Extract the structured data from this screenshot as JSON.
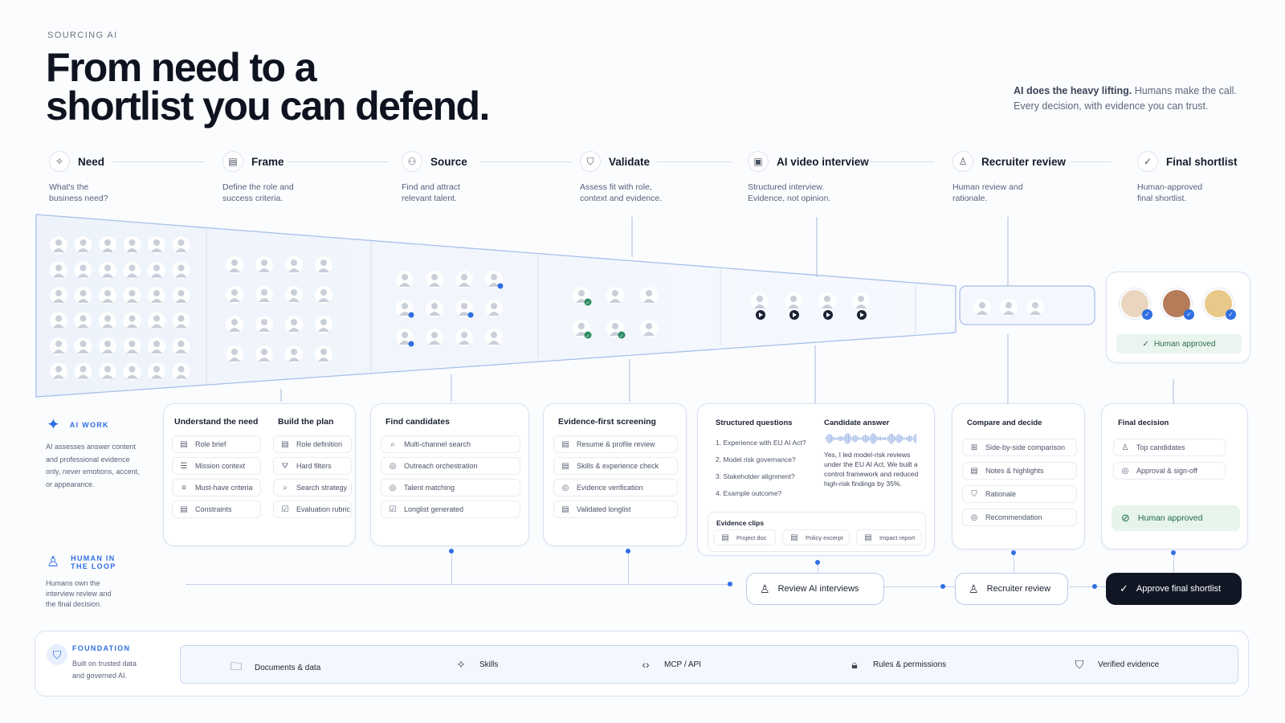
{
  "eyebrow": "SOURCING AI",
  "hero": {
    "line1": "From need to a",
    "line2": "shortlist you can defend."
  },
  "tagline": {
    "bold": "AI does the heavy lifting.",
    "rest": " Humans make the call.",
    "line2": "Every decision, with evidence you can trust."
  },
  "stages": [
    {
      "icon": "sparkle-icon",
      "title": "Need",
      "desc": "What's the business need?"
    },
    {
      "icon": "clipboard-icon",
      "title": "Frame",
      "desc": "Define the role and success criteria."
    },
    {
      "icon": "people-icon",
      "title": "Source",
      "desc": "Find and attract relevant talent."
    },
    {
      "icon": "shield-check-icon",
      "title": "Validate",
      "desc": "Assess fit with role, context and evidence."
    },
    {
      "icon": "video-icon",
      "title": "AI video interview",
      "desc": "Structured interview. Evidence, not opinion."
    },
    {
      "icon": "person-icon",
      "title": "Recruiter review",
      "desc": "Human review and rationale."
    },
    {
      "icon": "check-circle-icon",
      "title": "Final shortlist",
      "desc": "Human-approved final shortlist."
    }
  ],
  "shortlist": {
    "approved_label": "Human approved"
  },
  "ai_work": {
    "label": "AI WORK",
    "desc": "AI assesses answer content and professional evidence only, never emotions, accent, or appearance."
  },
  "hitl": {
    "label_line1": "HUMAN IN",
    "label_line2": "THE LOOP",
    "desc": "Humans own the interview review and the final decision."
  },
  "cards": {
    "frame": {
      "col1_title": "Understand the need",
      "col1_items": [
        "Role brief",
        "Mission context",
        "Must-have criteria",
        "Constraints"
      ],
      "col2_title": "Build the plan",
      "col2_items": [
        "Role definition",
        "Hard filters",
        "Search strategy",
        "Evaluation rubric"
      ]
    },
    "source": {
      "title": "Find candidates",
      "items": [
        "Multi-channel search",
        "Outreach orchestration",
        "Talent matching",
        "Longlist generated"
      ]
    },
    "validate": {
      "title": "Evidence-first screening",
      "items": [
        "Resume & profile review",
        "Skills & experience check",
        "Evidence verification",
        "Validated longlist"
      ]
    },
    "interview": {
      "q_title": "Structured questions",
      "questions": [
        "1. Experience with EU AI Act?",
        "2. Model risk governance?",
        "3. Stakeholder alignment?",
        "4. Example outcome?"
      ],
      "a_title": "Candidate answer",
      "answer": "Yes, I led model-risk reviews under the EU AI Act. We built a control framework and reduced high-risk findings by 35%.",
      "clips_title": "Evidence clips",
      "clips": [
        "Project doc",
        "Policy excerpt",
        "Impact report"
      ]
    },
    "review": {
      "title": "Compare and decide",
      "items": [
        "Side-by-side comparison",
        "Notes & highlights",
        "Rationale",
        "Recommendation"
      ]
    },
    "final": {
      "title": "Final decision",
      "items": [
        "Top candidates",
        "Approval & sign-off"
      ],
      "approved": "Human approved"
    }
  },
  "actions": {
    "review_interviews": "Review AI interviews",
    "recruiter_review": "Recruiter review",
    "approve": "Approve final shortlist"
  },
  "foundation": {
    "label": "FOUNDATION",
    "desc": "Built on trusted data and governed AI.",
    "items": [
      {
        "icon": "folder-icon",
        "label": "Documents & data"
      },
      {
        "icon": "sparkle-icon",
        "label": "Skills"
      },
      {
        "icon": "code-icon",
        "label": "MCP / API"
      },
      {
        "icon": "lock-icon",
        "label": "Rules & permissions"
      },
      {
        "icon": "shield-icon",
        "label": "Verified evidence"
      }
    ]
  },
  "colors": {
    "accent": "#2f6fe3",
    "success": "#2e8b62",
    "dark": "#101624"
  }
}
